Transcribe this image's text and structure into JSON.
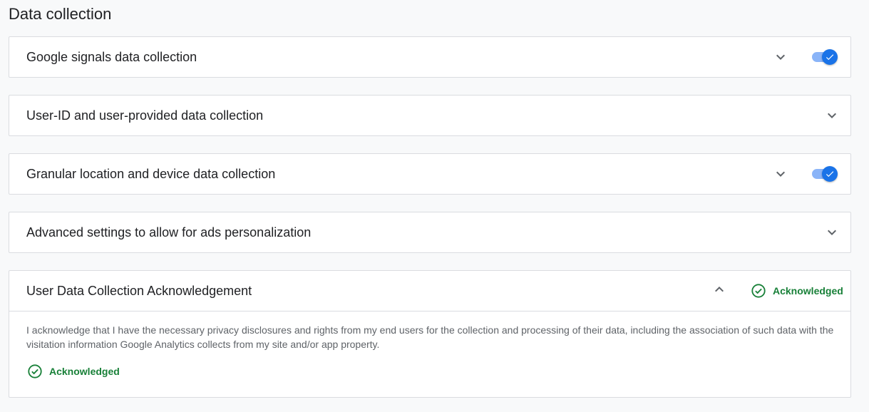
{
  "page": {
    "title": "Data collection"
  },
  "panels": [
    {
      "title": "Google signals data collection",
      "expanded": false,
      "toggle_on": true
    },
    {
      "title": "User-ID and user-provided data collection",
      "expanded": false
    },
    {
      "title": "Granular location and device data collection",
      "expanded": false,
      "toggle_on": true
    },
    {
      "title": "Advanced settings to allow for ads personalization",
      "expanded": false
    },
    {
      "title": "User Data Collection Acknowledgement",
      "expanded": true,
      "status": "Acknowledged",
      "body": "I acknowledge that I have the necessary privacy disclosures and rights from my end users for the collection and processing of their data, including the association of such data with the visitation information Google Analytics collects from my site and/or app property.",
      "body_status": "Acknowledged"
    }
  ],
  "colors": {
    "accent": "#1a73e8",
    "toggle_track": "#8ab4f8",
    "success": "#188038",
    "border": "#dadce0",
    "background": "#f8f9fa"
  },
  "icons": {
    "expand": "chevron-down-icon",
    "collapse": "chevron-up-icon",
    "toggle_check": "check-icon",
    "acknowledged": "check-circle-icon"
  }
}
